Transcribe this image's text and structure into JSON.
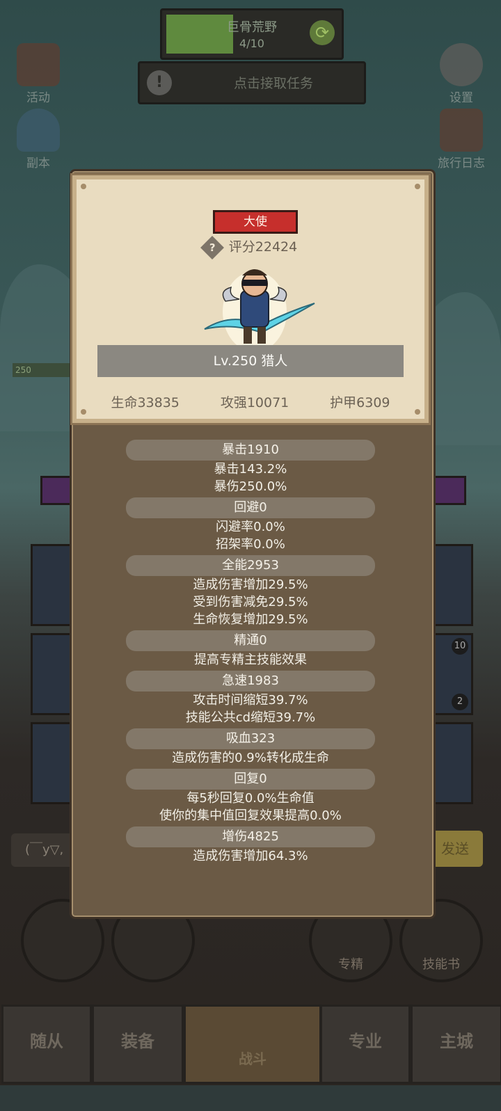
{
  "background": {
    "zone": {
      "name": "巨骨荒野",
      "progress": "4/10",
      "progress_value": 0.4
    },
    "quest_prompt": "点击接取任务",
    "left_buttons": [
      "活动",
      "副本"
    ],
    "right_buttons": [
      "设置",
      "旅行日志"
    ],
    "level_tag": "250",
    "chat_placeholder": "(￣y▽,",
    "send_label": "发送",
    "action_buttons": [
      "专精",
      "技能书"
    ],
    "nav_tabs": [
      "随从",
      "装备",
      "战斗",
      "专业",
      "主城"
    ],
    "slot_badges": [
      "10",
      "2"
    ]
  },
  "card": {
    "rank": "大使",
    "score": "评分22424",
    "hero_name": "Lv.250 猎人",
    "hp": "生命33835",
    "attack": "攻强10071",
    "armor": "护甲6309"
  },
  "attributes": [
    {
      "title": "暴击1910",
      "lines": [
        "暴击143.2%",
        "暴伤250.0%"
      ]
    },
    {
      "title": "回避0",
      "lines": [
        "闪避率0.0%",
        "招架率0.0%"
      ]
    },
    {
      "title": "全能2953",
      "lines": [
        "造成伤害增加29.5%",
        "受到伤害减免29.5%",
        "生命恢复增加29.5%"
      ]
    },
    {
      "title": "精通0",
      "lines": [
        "提高专精主技能效果"
      ]
    },
    {
      "title": "急速1983",
      "lines": [
        "攻击时间缩短39.7%",
        "技能公共cd缩短39.7%"
      ]
    },
    {
      "title": "吸血323",
      "lines": [
        "造成伤害的0.9%转化成生命"
      ]
    },
    {
      "title": "回复0",
      "lines": [
        "每5秒回复0.0%生命值",
        "使你的集中值回复效果提高0.0%"
      ]
    },
    {
      "title": "增伤4825",
      "lines": [
        "造成伤害增加64.3%"
      ]
    }
  ]
}
